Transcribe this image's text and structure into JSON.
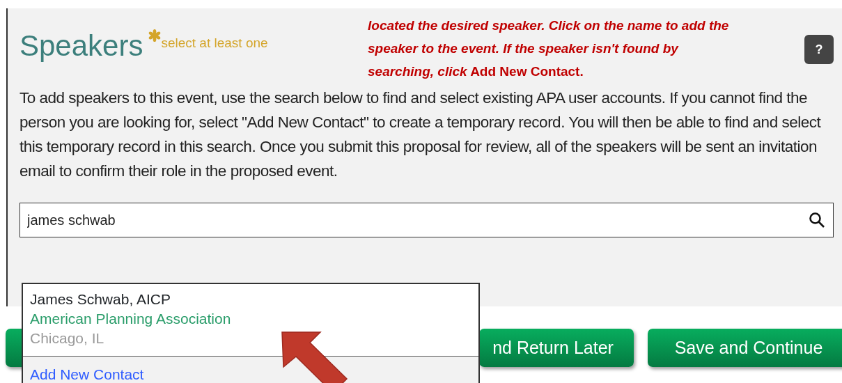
{
  "section": {
    "title": "Speakers",
    "required_note": "select at least one",
    "help_button": "?",
    "description": "To add speakers to this event, use the search below to find and select existing APA user accounts. If you cannot find the person you are looking for, select \"Add New Contact\" to create a temporary record. You will then be able to find and select this temporary record in this search. Once you submit this proposal for review, all of the speakers will be sent an invitation email to confirm their role in the proposed event.",
    "search": {
      "value": "james schwab"
    }
  },
  "annotation": "*located the desired speaker. Click on the name to add the speaker to the event. If the speaker isn't found by searching, click* Add New Contact.",
  "dropdown": [
    {
      "kind": "result",
      "name": "James Schwab, AICP",
      "organization": "American Planning Association",
      "location": "Chicago, IL"
    },
    {
      "kind": "action",
      "label": "Add New Contact"
    }
  ],
  "buttons": [
    {
      "kind": "covered"
    },
    {
      "kind": "labeled",
      "label": "nd Return Later"
    },
    {
      "kind": "labeled",
      "label": "Save and Continue"
    }
  ]
}
